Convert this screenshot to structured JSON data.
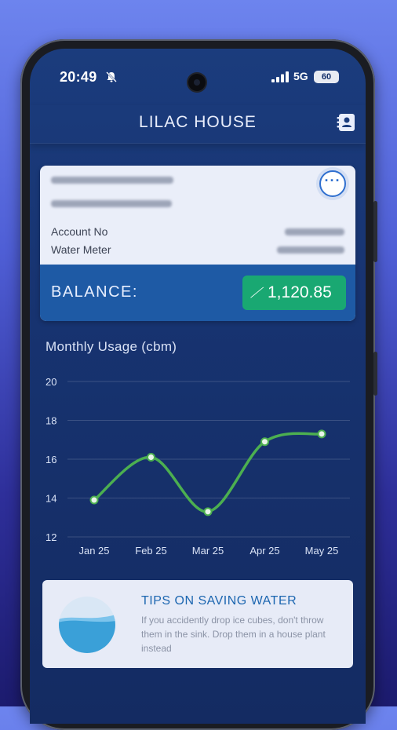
{
  "status_bar": {
    "time": "20:49",
    "network": "5G",
    "battery": "60"
  },
  "header": {
    "title": "LILAC HOUSE"
  },
  "account_card": {
    "account_no_label": "Account No",
    "water_meter_label": "Water Meter",
    "balance_label": "BALANCE:",
    "balance_amount": "1,120.85"
  },
  "chart_title": "Monthly Usage (cbm)",
  "chart_data": {
    "type": "line",
    "title": "Monthly Usage (cbm)",
    "categories": [
      "Jan 25",
      "Feb 25",
      "Mar 25",
      "Apr 25",
      "May 25"
    ],
    "values": [
      13.9,
      16.1,
      13.3,
      16.9,
      17.3
    ],
    "ylim": [
      12,
      20
    ],
    "yticks": [
      12,
      14,
      16,
      18,
      20
    ],
    "grid": true,
    "line_color": "#4caf50",
    "point_color": "#e8f5e9"
  },
  "tips": {
    "title": "TIPS ON SAVING WATER",
    "text": "If you accidently drop ice cubes, don't throw them in the sink. Drop them in a house plant instead"
  },
  "colors": {
    "accent": "#1e5aa5",
    "balance": "#19a872",
    "line": "#4caf50"
  }
}
